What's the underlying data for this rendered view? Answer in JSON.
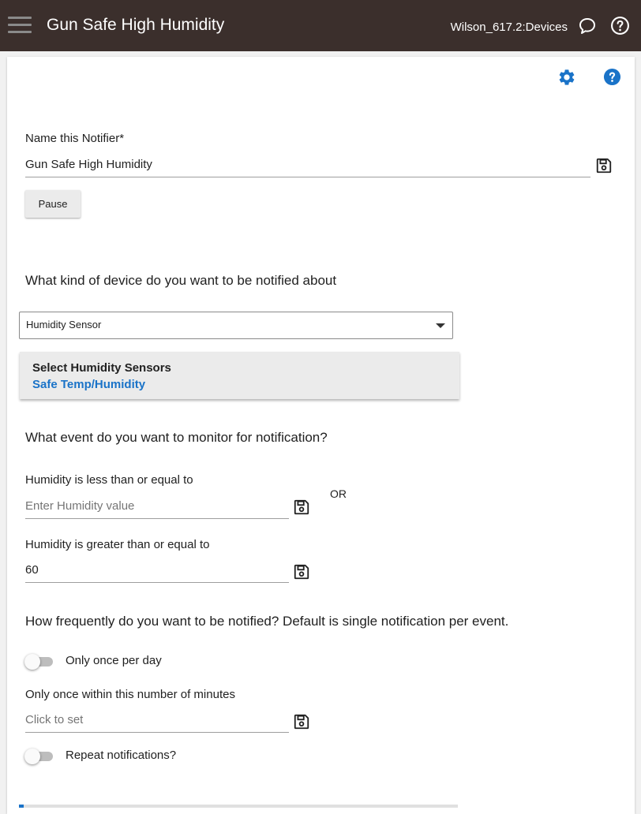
{
  "header": {
    "title": "Gun Safe High Humidity",
    "hub_name": "Wilson_617.2:Devices",
    "menu_icon": "hamburger-menu-icon",
    "chat_icon": "chat-bubble-icon",
    "help_icon": "question-circle-icon"
  },
  "toolbar": {
    "settings_icon": "gear-icon",
    "help_icon": "help-circle-icon"
  },
  "notifier": {
    "name_label": "Name this Notifier*",
    "name_value": "Gun Safe High Humidity",
    "pause_label": "Pause"
  },
  "device": {
    "question": "What kind of device do you want to be notified about",
    "type_selected": "Humidity Sensor",
    "select_title": "Select Humidity Sensors",
    "selected_device": "Safe Temp/Humidity"
  },
  "event": {
    "question": "What event do you want to monitor for notification?",
    "less_label": "Humidity is less than or equal to",
    "less_placeholder": "Enter Humidity value",
    "less_value": "",
    "or_label": "OR",
    "greater_label": "Humidity is greater than or equal to",
    "greater_value": "60"
  },
  "frequency": {
    "question": "How frequently do you want to be notified?  Default is single notification per event.",
    "once_per_day_label": "Only once per day",
    "once_per_day_on": false,
    "minutes_label": "Only once within this number of minutes",
    "minutes_placeholder": "Click to set",
    "repeat_label": "Repeat notifications?",
    "repeat_on": false
  },
  "colors": {
    "header_bg": "#3b2f2c",
    "accent": "#1a73c8"
  }
}
